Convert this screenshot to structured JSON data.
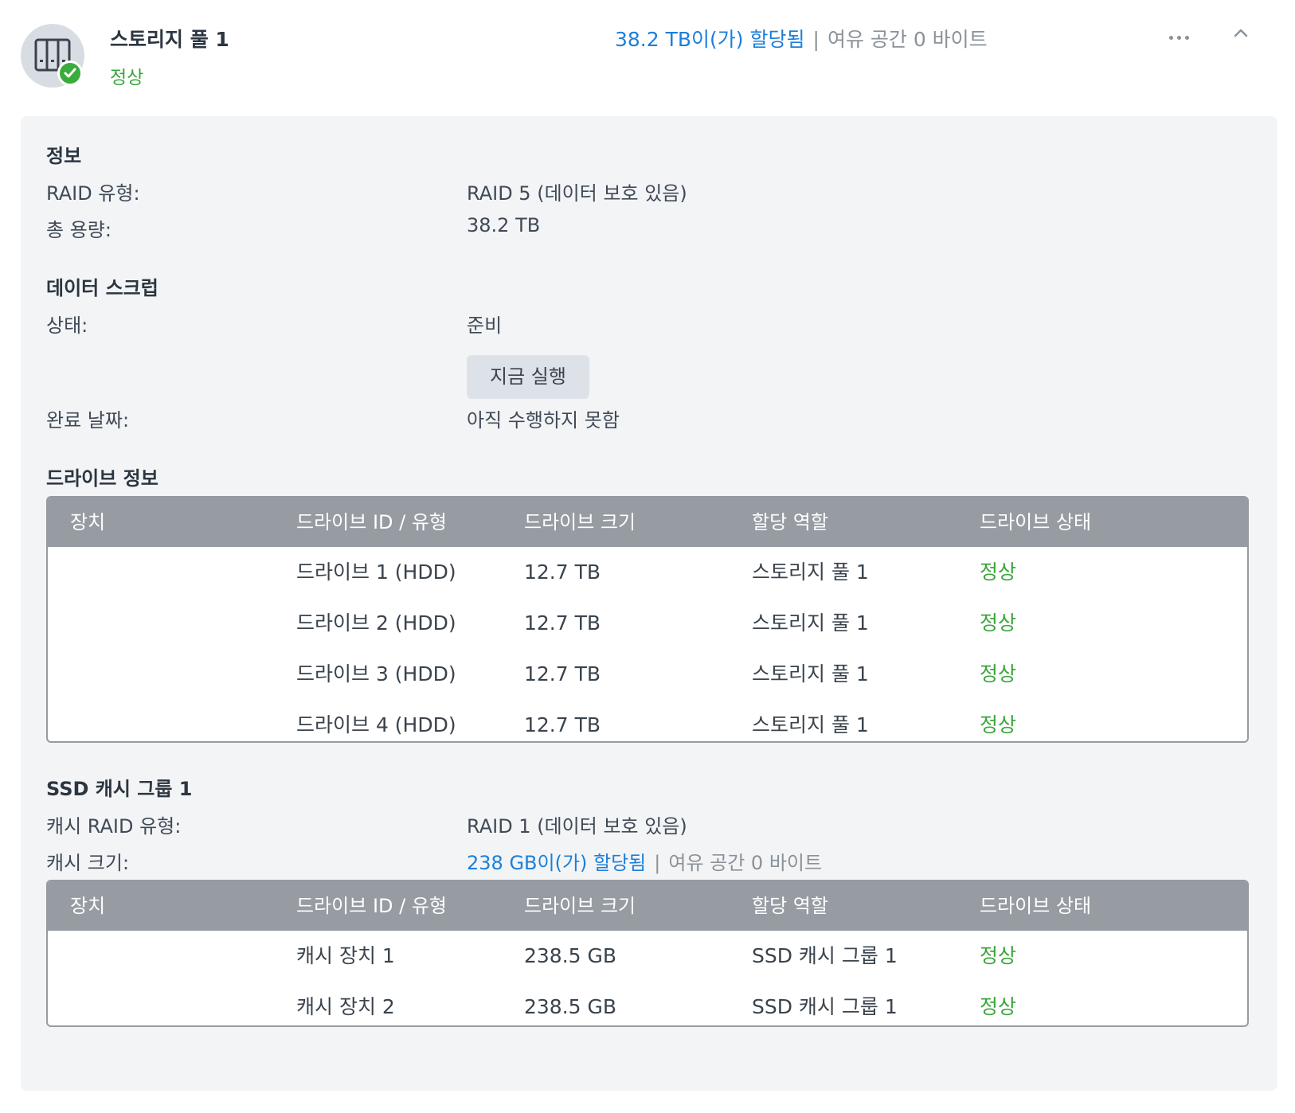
{
  "header": {
    "title": "스토리지 풀 1",
    "status": "정상",
    "allocated": "38.2 TB이(가) 할당됨",
    "separator": "|",
    "free": "여유 공간 0 바이트",
    "icon": "nas-drive-icon",
    "status_icon": "check-circle-icon"
  },
  "info": {
    "title": "정보",
    "raid_label": "RAID 유형:",
    "raid_value": "RAID 5 (데이터 보호 있음)",
    "capacity_label": "총 용량:",
    "capacity_value": "38.2 TB"
  },
  "scrub": {
    "title": "데이터 스크럽",
    "status_label": "상태:",
    "status_value": "준비",
    "run_button": "지금 실행",
    "completed_label": "완료 날짜:",
    "completed_value": "아직 수행하지 못함"
  },
  "drive_info": {
    "title": "드라이브 정보",
    "columns": [
      "장치",
      "드라이브 ID / 유형",
      "드라이브 크기",
      "할당 역할",
      "드라이브 상태"
    ],
    "rows": [
      {
        "device": "",
        "id": "드라이브 1 (HDD)",
        "size": "12.7 TB",
        "role": "스토리지 풀 1",
        "status": "정상"
      },
      {
        "device": "",
        "id": "드라이브 2 (HDD)",
        "size": "12.7 TB",
        "role": "스토리지 풀 1",
        "status": "정상"
      },
      {
        "device": "",
        "id": "드라이브 3 (HDD)",
        "size": "12.7 TB",
        "role": "스토리지 풀 1",
        "status": "정상"
      },
      {
        "device": "",
        "id": "드라이브 4 (HDD)",
        "size": "12.7 TB",
        "role": "스토리지 풀 1",
        "status": "정상"
      }
    ]
  },
  "ssd_cache": {
    "title": "SSD 캐시 그룹 1",
    "raid_label": "캐시 RAID 유형:",
    "raid_value": "RAID 1 (데이터 보호 있음)",
    "size_label": "캐시 크기:",
    "size_allocated": "238 GB이(가) 할당됨",
    "size_separator": "|",
    "size_free": "여유 공간 0 바이트",
    "columns": [
      "장치",
      "드라이브 ID / 유형",
      "드라이브 크기",
      "할당 역할",
      "드라이브 상태"
    ],
    "rows": [
      {
        "device": "",
        "id": "캐시 장치 1",
        "size": "238.5 GB",
        "role": "SSD 캐시 그룹 1",
        "status": "정상"
      },
      {
        "device": "",
        "id": "캐시 장치 2",
        "size": "238.5 GB",
        "role": "SSD 캐시 그룹 1",
        "status": "정상"
      }
    ]
  },
  "colors": {
    "accent_blue": "#1c7fd9",
    "status_green": "#3aa53a",
    "table_header": "#979ca3",
    "panel_bg": "#f3f4f6"
  }
}
